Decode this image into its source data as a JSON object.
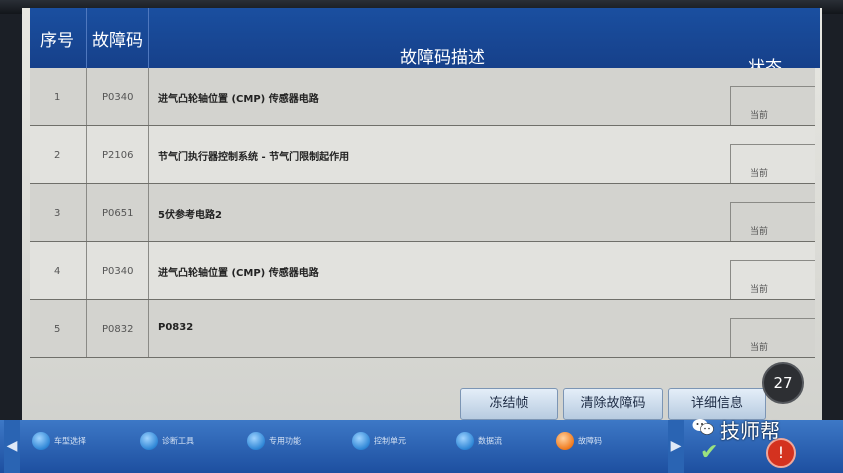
{
  "table": {
    "headers": {
      "no": "序号",
      "code": "故障码",
      "desc": "故障码描述",
      "status": "状态"
    },
    "rows": [
      {
        "no": "1",
        "code": "P0340",
        "desc": "进气凸轮轴位置 (CMP) 传感器电路",
        "status": "当前"
      },
      {
        "no": "2",
        "code": "P2106",
        "desc": "节气门执行器控制系统 - 节气门限制起作用",
        "status": "当前"
      },
      {
        "no": "3",
        "code": "P0651",
        "desc": "5伏参考电路2",
        "status": "当前"
      },
      {
        "no": "4",
        "code": "P0340",
        "desc": "进气凸轮轴位置 (CMP) 传感器电路",
        "status": "当前"
      },
      {
        "no": "5",
        "code": "P0832",
        "desc": "P0832",
        "status": "当前"
      }
    ]
  },
  "buttons": {
    "freeze": "冻结帧",
    "clear": "清除故障码",
    "details": "详细信息"
  },
  "timer": "27",
  "watermark": "技师帮",
  "bottom_nav": [
    "车型选择",
    "诊断工具",
    "专用功能",
    "控制单元",
    "数据流",
    "故障码"
  ]
}
